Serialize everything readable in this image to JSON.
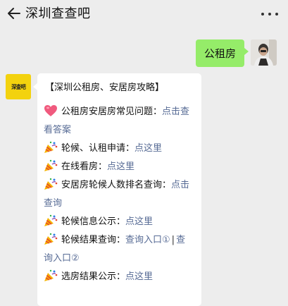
{
  "header": {
    "title": "深圳查查吧"
  },
  "outgoing": {
    "text": "公租房"
  },
  "bot_avatar": {
    "text": "深查吧"
  },
  "incoming": {
    "title": "【深圳公租房、安居房攻略】",
    "items": [
      {
        "icon": "heart-icon",
        "label": "公租房安居房常见问题：",
        "link1": "点击查看答案"
      },
      {
        "icon": "party-popper-icon",
        "label": "轮候、认租申请：",
        "link1": "点这里"
      },
      {
        "icon": "party-popper-icon",
        "label": "在线看房：",
        "link1": "点这里"
      },
      {
        "icon": "party-popper-icon",
        "label": "安居房轮候人数排名查询：",
        "link1": "点击查询"
      },
      {
        "icon": "party-popper-icon",
        "label": "轮候信息公示：",
        "link1": "点这里"
      },
      {
        "icon": "party-popper-icon",
        "label": "轮候结果查询：",
        "link1": "查询入口①",
        "separator": "|",
        "link2": "查询入口②"
      },
      {
        "icon": "party-popper-icon",
        "label": "选房结果公示：",
        "link1": "点这里"
      }
    ]
  },
  "colors": {
    "background": "#ededed",
    "outgoing_bubble": "#95ec69",
    "link": "#576b95",
    "bot_avatar": "#f3d20e"
  }
}
